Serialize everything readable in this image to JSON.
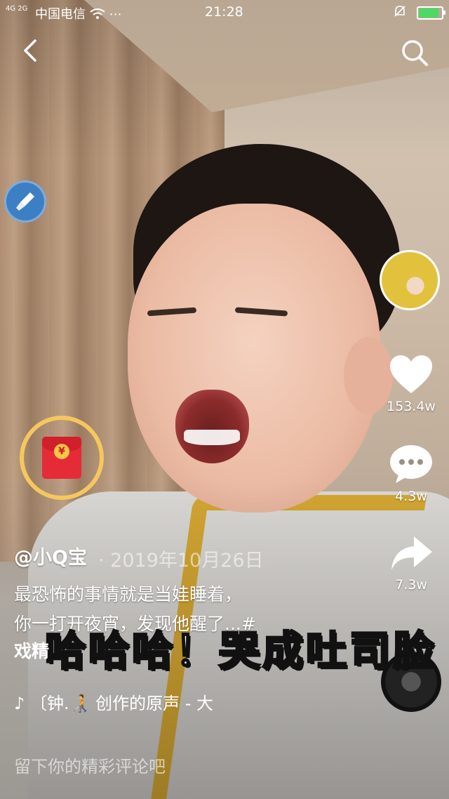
{
  "status_bar": {
    "signal": "4G 2G",
    "carrier": "中国电信",
    "more": "⋯",
    "time": "21:28"
  },
  "video": {
    "author": "@小Q宝",
    "date": "· 2019年10月26日",
    "caption_line1": "最恐怖的事情就是当娃睡着，",
    "caption_line2": "你一打开夜宵，发现他醒了...#",
    "caption_line3": "戏精",
    "overlay_text": "哈哈哈！哭成吐司脸",
    "music": "♪ 〔钟.🧑‍🦯 创作的原声 - 大"
  },
  "rail": {
    "likes": "153.4w",
    "comments": "4.3w",
    "shares": "7.3w"
  },
  "comment_placeholder": "留下你的精彩评论吧",
  "icons": {
    "back": "back-arrow-icon",
    "search": "search-icon",
    "brush": "brush-icon",
    "red_packet": "red-packet-icon",
    "heart": "heart-icon",
    "comment": "comment-bubble-icon",
    "share": "share-arrow-icon",
    "music_disc": "music-disc-icon"
  },
  "colors": {
    "accent_ring": "#f5c85d",
    "red_packet": "#e52b38",
    "battery": "#4cd964"
  }
}
